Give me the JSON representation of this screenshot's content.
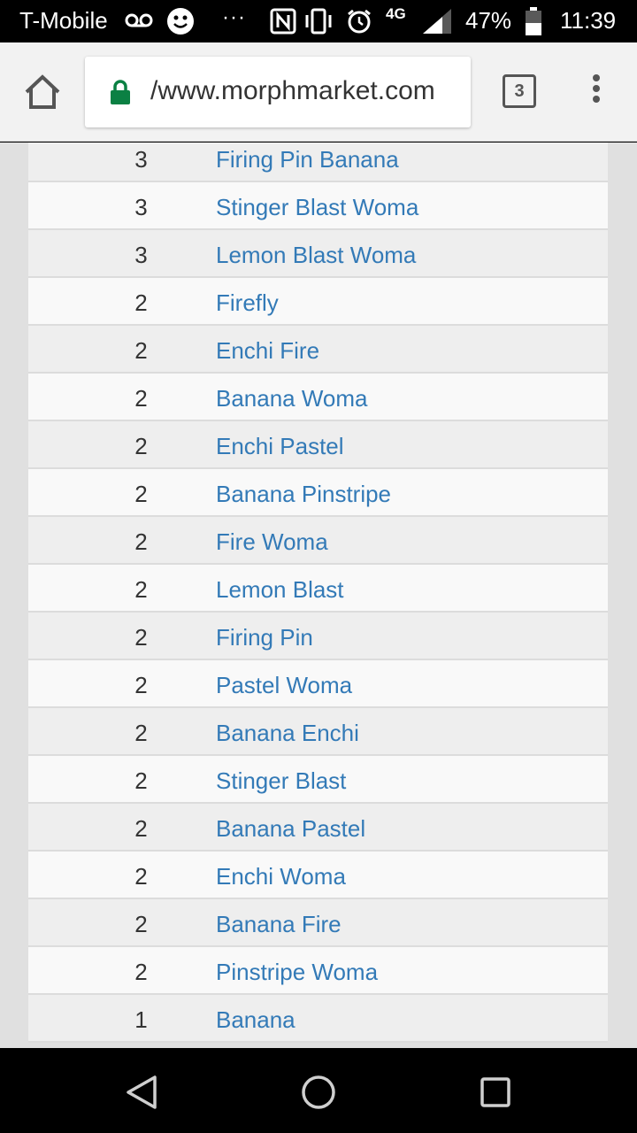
{
  "status_bar": {
    "carrier": "T-Mobile",
    "dots": "···",
    "network": "4G",
    "battery_pct": "47%",
    "time": "11:39"
  },
  "browser": {
    "url": "/www.morphmarket.com",
    "tab_count": "3"
  },
  "table": {
    "rows": [
      {
        "count": "3",
        "name": "Firing Pin Banana"
      },
      {
        "count": "3",
        "name": "Stinger Blast Woma"
      },
      {
        "count": "3",
        "name": "Lemon Blast Woma"
      },
      {
        "count": "2",
        "name": "Firefly"
      },
      {
        "count": "2",
        "name": "Enchi Fire"
      },
      {
        "count": "2",
        "name": "Banana Woma"
      },
      {
        "count": "2",
        "name": "Enchi Pastel"
      },
      {
        "count": "2",
        "name": "Banana Pinstripe"
      },
      {
        "count": "2",
        "name": "Fire Woma"
      },
      {
        "count": "2",
        "name": "Lemon Blast"
      },
      {
        "count": "2",
        "name": "Firing Pin"
      },
      {
        "count": "2",
        "name": "Pastel Woma"
      },
      {
        "count": "2",
        "name": "Banana Enchi"
      },
      {
        "count": "2",
        "name": "Stinger Blast"
      },
      {
        "count": "2",
        "name": "Banana Pastel"
      },
      {
        "count": "2",
        "name": "Enchi Woma"
      },
      {
        "count": "2",
        "name": "Banana Fire"
      },
      {
        "count": "2",
        "name": "Pinstripe Woma"
      },
      {
        "count": "1",
        "name": "Banana"
      }
    ]
  },
  "icons": {
    "status": [
      "voicemail-icon",
      "smiley-icon",
      "nfc-icon",
      "vibrate-icon",
      "alarm-icon",
      "signal-icon",
      "battery-icon"
    ],
    "toolbar": [
      "home-icon",
      "lock-icon",
      "tabs-icon",
      "menu-icon"
    ],
    "nav": [
      "back-icon",
      "home-circle-icon",
      "recents-icon"
    ]
  },
  "colors": {
    "link": "#337ab7",
    "lock": "#0b8043"
  }
}
